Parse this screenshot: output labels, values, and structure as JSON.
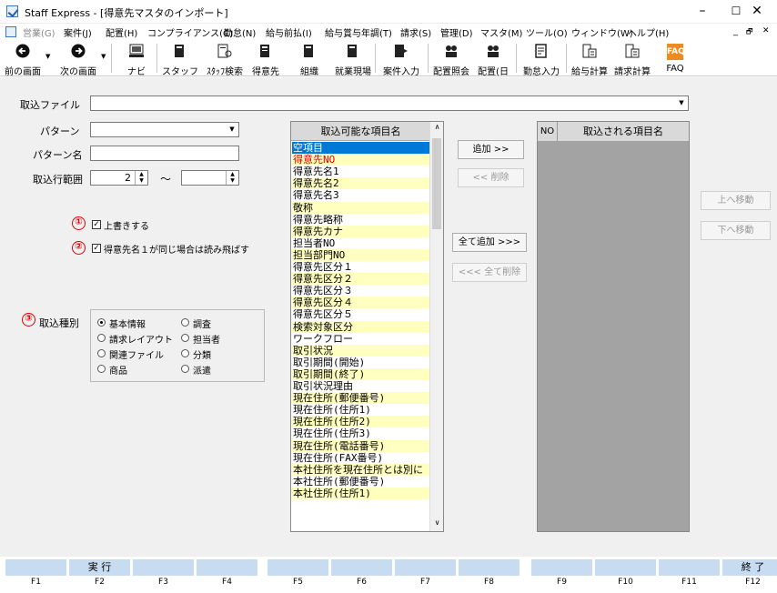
{
  "window": {
    "title": "Staff Express - [得意先マスタのインポート]",
    "min": "–",
    "max": "☐",
    "close": "✕"
  },
  "menu": [
    "営業(G)",
    "案件(J)",
    "配置(H)",
    "コンプライアンス(C)",
    "勤怠(N)",
    "給与前払(I)",
    "給与賞与年調(T)",
    "請求(S)",
    "管理(D)",
    "マスタ(M)",
    "ツール(O)",
    "ウィンドウ(W)",
    "ヘルプ(H)"
  ],
  "mdi": {
    "min": "_",
    "restore": "🗗",
    "close": "✕"
  },
  "toolbar": [
    {
      "label": "前の画面",
      "icon": "back-arrow-icon"
    },
    {
      "label": "次の画面",
      "icon": "forward-arrow-icon"
    },
    {
      "label": "ナビ",
      "icon": "navi-icon"
    },
    {
      "label": "スタッフ",
      "icon": "staff-icon"
    },
    {
      "label": "ｽﾀｯﾌ検索",
      "icon": "staff-search-icon"
    },
    {
      "label": "得意先",
      "icon": "customer-icon"
    },
    {
      "label": "組織",
      "icon": "organization-icon"
    },
    {
      "label": "就業現場",
      "icon": "worksite-icon"
    },
    {
      "label": "案件入力",
      "icon": "case-input-icon"
    },
    {
      "label": "配置照会",
      "icon": "placement-query-icon"
    },
    {
      "label": "配置(日",
      "icon": "placement-daily-icon"
    },
    {
      "label": "勤怠入力",
      "icon": "attendance-input-icon"
    },
    {
      "label": "給与計算",
      "icon": "payroll-icon"
    },
    {
      "label": "請求計算",
      "icon": "billing-icon"
    },
    {
      "label": "FAQ",
      "icon": "faq-icon"
    }
  ],
  "form": {
    "file_label": "取込ファイル",
    "file_value": "",
    "pattern_label": "パターン",
    "pattern_value": "",
    "pattern_name_label": "パターン名",
    "pattern_name_value": "",
    "range_label": "取込行範囲",
    "range_from": "2",
    "range_tilde": "～",
    "range_to": ""
  },
  "options": {
    "overwrite_num": "①",
    "overwrite_label": "上書きする",
    "overwrite_checked": "✓",
    "skip_num": "②",
    "skip_label": "得意先名１が同じ場合は読み飛ばす",
    "skip_checked": "✓",
    "kind_num": "③",
    "kind_label": "取込種別",
    "kinds": [
      "基本情報",
      "調査",
      "請求レイアウト",
      "担当者",
      "関連ファイル",
      "分類",
      "商品",
      "派遣"
    ],
    "kind_selected": "基本情報"
  },
  "available": {
    "header": "取込可能な項目名",
    "items": [
      "空項目",
      "得意先NO",
      "得意先名1",
      "得意先名2",
      "得意先名3",
      "敬称",
      "得意先略称",
      "得意先カナ",
      "担当者NO",
      "担当部門NO",
      "得意先区分１",
      "得意先区分２",
      "得意先区分３",
      "得意先区分４",
      "得意先区分５",
      "検索対象区分",
      "ワークフロー",
      "取引状況",
      "取引期間(開始)",
      "取引期間(終了)",
      "取引状況理由",
      "現在住所(郵便番号)",
      "現在住所(住所1)",
      "現在住所(住所2)",
      "現在住所(住所3)",
      "現在住所(電話番号)",
      "現在住所(FAX番号)",
      "本社住所を現在住所とは別に",
      "本社住所(郵便番号)",
      "本社住所(住所1)"
    ]
  },
  "buttons": {
    "add": "追加 >>",
    "remove": "<< 削除",
    "add_all": "全て追加 >>>",
    "remove_all": "<<< 全て削除",
    "move_up": "上へ移動",
    "move_down": "下へ移動"
  },
  "selected": {
    "no_header": "NO",
    "name_header": "取込される項目名"
  },
  "fkeys": [
    {
      "key": "F1",
      "label": ""
    },
    {
      "key": "F2",
      "label": "実 行"
    },
    {
      "key": "F3",
      "label": ""
    },
    {
      "key": "F4",
      "label": ""
    },
    {
      "key": "F5",
      "label": ""
    },
    {
      "key": "F6",
      "label": ""
    },
    {
      "key": "F7",
      "label": ""
    },
    {
      "key": "F8",
      "label": ""
    },
    {
      "key": "F9",
      "label": ""
    },
    {
      "key": "F10",
      "label": ""
    },
    {
      "key": "F11",
      "label": ""
    },
    {
      "key": "F12",
      "label": "終 了"
    }
  ],
  "colors": {
    "row_yellow": "#ffffc0",
    "row_white": "#ffffff",
    "selected_row": "#0078d7",
    "red_text": "#e00000",
    "fkey_bg": "#c7dcf0"
  }
}
